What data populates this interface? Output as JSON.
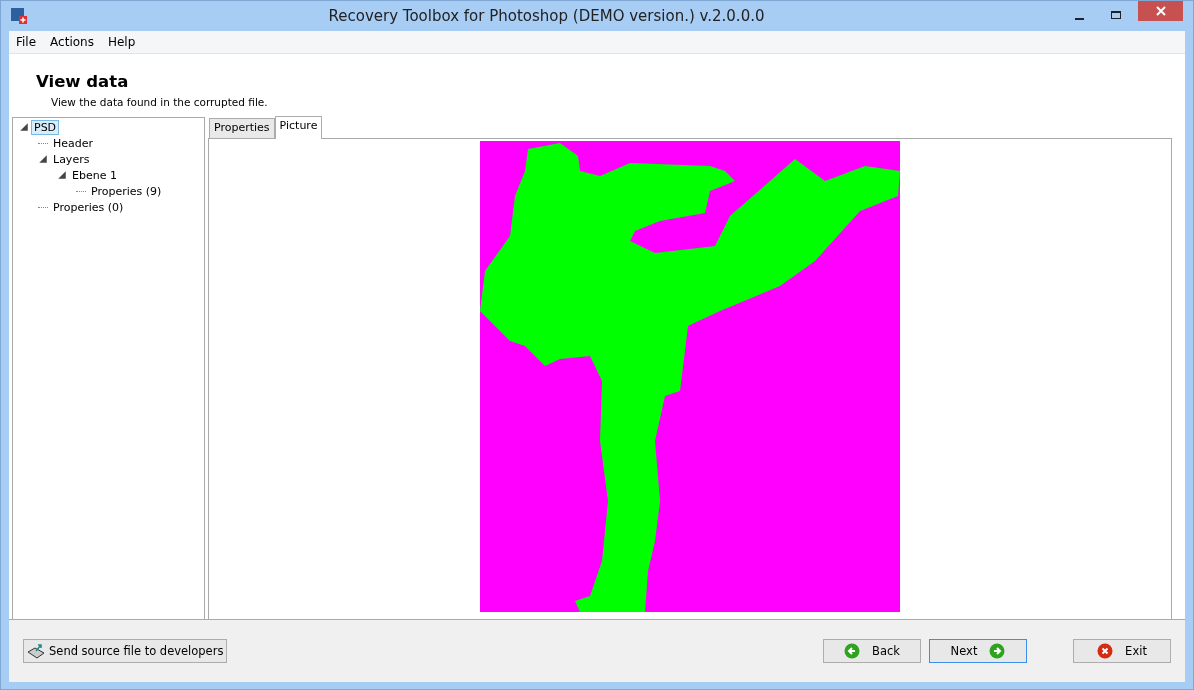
{
  "window": {
    "title": "Recovery Toolbox for Photoshop (DEMO version.) v.2.0.0.0"
  },
  "menu": [
    "File",
    "Actions",
    "Help"
  ],
  "header": {
    "title": "View data",
    "subtitle": "View the data found in the corrupted file."
  },
  "tree": [
    {
      "label": "PSD",
      "selected": true,
      "expanded": true,
      "children": [
        {
          "label": "Header",
          "selected": false
        },
        {
          "label": "Layers",
          "selected": false,
          "expanded": true,
          "children": [
            {
              "label": "Ebene 1",
              "selected": false,
              "expanded": true,
              "children": [
                {
                  "label": "Properies (9)",
                  "selected": false
                }
              ]
            }
          ]
        },
        {
          "label": "Properies (0)",
          "selected": false
        }
      ]
    }
  ],
  "tabs": [
    {
      "label": "Properties",
      "selected": false
    },
    {
      "label": "Picture",
      "selected": true
    }
  ],
  "footer": {
    "send_button": "Send source file to developers",
    "buttons": [
      {
        "kind": "back",
        "label": "Back",
        "focused": false
      },
      {
        "kind": "next",
        "label": "Next",
        "focused": true
      },
      {
        "kind": "exit",
        "label": "Exit",
        "focused": false
      }
    ]
  }
}
